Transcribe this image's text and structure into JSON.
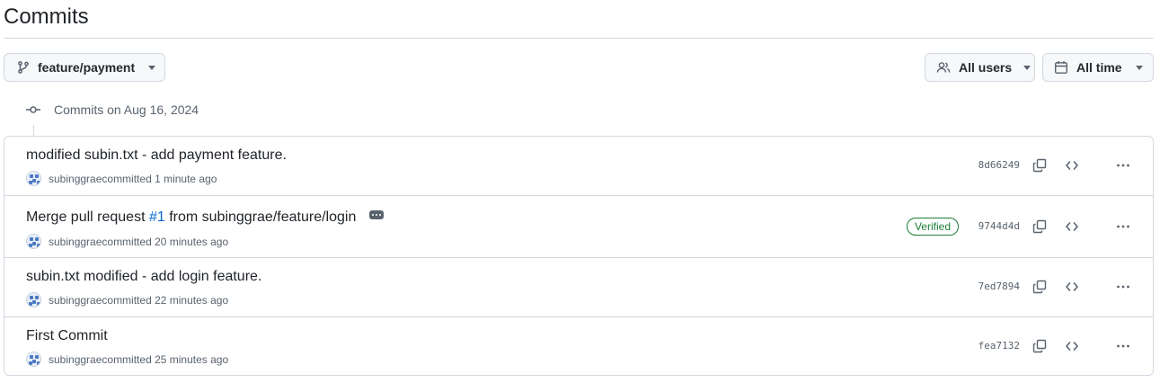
{
  "page": {
    "title": "Commits"
  },
  "toolbar": {
    "branch_label": "feature/payment",
    "users_label": "All users",
    "time_label": "All time"
  },
  "group": {
    "heading": "Commits on Aug 16, 2024"
  },
  "commits": [
    {
      "message": "modified subin.txt - add payment feature.",
      "author": "subinggrae",
      "committed_text": " committed 1 minute ago",
      "sha": "8d66249",
      "verified": ""
    },
    {
      "message_prefix": "Merge pull request ",
      "pr_ref": "#1",
      "message_suffix": " from subinggrae/feature/login",
      "author": "subinggrae",
      "committed_text": " committed 20 minutes ago",
      "sha": "9744d4d",
      "verified": "Verified"
    },
    {
      "message": "subin.txt modified - add login feature.",
      "author": "subinggrae",
      "committed_text": " committed 22 minutes ago",
      "sha": "7ed7894",
      "verified": ""
    },
    {
      "message": "First Commit",
      "author": "subinggrae",
      "committed_text": " committed 25 minutes ago",
      "sha": "fea7132",
      "verified": ""
    }
  ],
  "icons": {
    "branch": "git-branch-icon",
    "people": "people-icon",
    "calendar": "calendar-icon",
    "commit": "git-commit-icon",
    "copy": "copy-icon",
    "browse": "code-icon",
    "more": "kebab-horizontal-icon"
  },
  "colors": {
    "accent_link": "#0969da",
    "verified_green": "#1a7f37",
    "border": "#d1d9e0",
    "muted": "#59636e"
  }
}
